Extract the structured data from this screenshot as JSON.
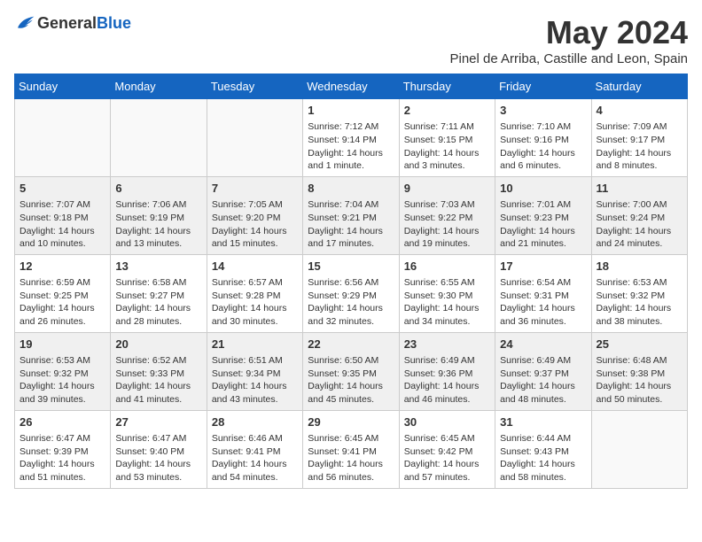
{
  "logo": {
    "general": "General",
    "blue": "Blue"
  },
  "title": "May 2024",
  "location": "Pinel de Arriba, Castille and Leon, Spain",
  "days_of_week": [
    "Sunday",
    "Monday",
    "Tuesday",
    "Wednesday",
    "Thursday",
    "Friday",
    "Saturday"
  ],
  "weeks": [
    [
      {
        "day": "",
        "info": ""
      },
      {
        "day": "",
        "info": ""
      },
      {
        "day": "",
        "info": ""
      },
      {
        "day": "1",
        "sunrise": "Sunrise: 7:12 AM",
        "sunset": "Sunset: 9:14 PM",
        "daylight": "Daylight: 14 hours and 1 minute."
      },
      {
        "day": "2",
        "sunrise": "Sunrise: 7:11 AM",
        "sunset": "Sunset: 9:15 PM",
        "daylight": "Daylight: 14 hours and 3 minutes."
      },
      {
        "day": "3",
        "sunrise": "Sunrise: 7:10 AM",
        "sunset": "Sunset: 9:16 PM",
        "daylight": "Daylight: 14 hours and 6 minutes."
      },
      {
        "day": "4",
        "sunrise": "Sunrise: 7:09 AM",
        "sunset": "Sunset: 9:17 PM",
        "daylight": "Daylight: 14 hours and 8 minutes."
      }
    ],
    [
      {
        "day": "5",
        "sunrise": "Sunrise: 7:07 AM",
        "sunset": "Sunset: 9:18 PM",
        "daylight": "Daylight: 14 hours and 10 minutes."
      },
      {
        "day": "6",
        "sunrise": "Sunrise: 7:06 AM",
        "sunset": "Sunset: 9:19 PM",
        "daylight": "Daylight: 14 hours and 13 minutes."
      },
      {
        "day": "7",
        "sunrise": "Sunrise: 7:05 AM",
        "sunset": "Sunset: 9:20 PM",
        "daylight": "Daylight: 14 hours and 15 minutes."
      },
      {
        "day": "8",
        "sunrise": "Sunrise: 7:04 AM",
        "sunset": "Sunset: 9:21 PM",
        "daylight": "Daylight: 14 hours and 17 minutes."
      },
      {
        "day": "9",
        "sunrise": "Sunrise: 7:03 AM",
        "sunset": "Sunset: 9:22 PM",
        "daylight": "Daylight: 14 hours and 19 minutes."
      },
      {
        "day": "10",
        "sunrise": "Sunrise: 7:01 AM",
        "sunset": "Sunset: 9:23 PM",
        "daylight": "Daylight: 14 hours and 21 minutes."
      },
      {
        "day": "11",
        "sunrise": "Sunrise: 7:00 AM",
        "sunset": "Sunset: 9:24 PM",
        "daylight": "Daylight: 14 hours and 24 minutes."
      }
    ],
    [
      {
        "day": "12",
        "sunrise": "Sunrise: 6:59 AM",
        "sunset": "Sunset: 9:25 PM",
        "daylight": "Daylight: 14 hours and 26 minutes."
      },
      {
        "day": "13",
        "sunrise": "Sunrise: 6:58 AM",
        "sunset": "Sunset: 9:27 PM",
        "daylight": "Daylight: 14 hours and 28 minutes."
      },
      {
        "day": "14",
        "sunrise": "Sunrise: 6:57 AM",
        "sunset": "Sunset: 9:28 PM",
        "daylight": "Daylight: 14 hours and 30 minutes."
      },
      {
        "day": "15",
        "sunrise": "Sunrise: 6:56 AM",
        "sunset": "Sunset: 9:29 PM",
        "daylight": "Daylight: 14 hours and 32 minutes."
      },
      {
        "day": "16",
        "sunrise": "Sunrise: 6:55 AM",
        "sunset": "Sunset: 9:30 PM",
        "daylight": "Daylight: 14 hours and 34 minutes."
      },
      {
        "day": "17",
        "sunrise": "Sunrise: 6:54 AM",
        "sunset": "Sunset: 9:31 PM",
        "daylight": "Daylight: 14 hours and 36 minutes."
      },
      {
        "day": "18",
        "sunrise": "Sunrise: 6:53 AM",
        "sunset": "Sunset: 9:32 PM",
        "daylight": "Daylight: 14 hours and 38 minutes."
      }
    ],
    [
      {
        "day": "19",
        "sunrise": "Sunrise: 6:53 AM",
        "sunset": "Sunset: 9:32 PM",
        "daylight": "Daylight: 14 hours and 39 minutes."
      },
      {
        "day": "20",
        "sunrise": "Sunrise: 6:52 AM",
        "sunset": "Sunset: 9:33 PM",
        "daylight": "Daylight: 14 hours and 41 minutes."
      },
      {
        "day": "21",
        "sunrise": "Sunrise: 6:51 AM",
        "sunset": "Sunset: 9:34 PM",
        "daylight": "Daylight: 14 hours and 43 minutes."
      },
      {
        "day": "22",
        "sunrise": "Sunrise: 6:50 AM",
        "sunset": "Sunset: 9:35 PM",
        "daylight": "Daylight: 14 hours and 45 minutes."
      },
      {
        "day": "23",
        "sunrise": "Sunrise: 6:49 AM",
        "sunset": "Sunset: 9:36 PM",
        "daylight": "Daylight: 14 hours and 46 minutes."
      },
      {
        "day": "24",
        "sunrise": "Sunrise: 6:49 AM",
        "sunset": "Sunset: 9:37 PM",
        "daylight": "Daylight: 14 hours and 48 minutes."
      },
      {
        "day": "25",
        "sunrise": "Sunrise: 6:48 AM",
        "sunset": "Sunset: 9:38 PM",
        "daylight": "Daylight: 14 hours and 50 minutes."
      }
    ],
    [
      {
        "day": "26",
        "sunrise": "Sunrise: 6:47 AM",
        "sunset": "Sunset: 9:39 PM",
        "daylight": "Daylight: 14 hours and 51 minutes."
      },
      {
        "day": "27",
        "sunrise": "Sunrise: 6:47 AM",
        "sunset": "Sunset: 9:40 PM",
        "daylight": "Daylight: 14 hours and 53 minutes."
      },
      {
        "day": "28",
        "sunrise": "Sunrise: 6:46 AM",
        "sunset": "Sunset: 9:41 PM",
        "daylight": "Daylight: 14 hours and 54 minutes."
      },
      {
        "day": "29",
        "sunrise": "Sunrise: 6:45 AM",
        "sunset": "Sunset: 9:41 PM",
        "daylight": "Daylight: 14 hours and 56 minutes."
      },
      {
        "day": "30",
        "sunrise": "Sunrise: 6:45 AM",
        "sunset": "Sunset: 9:42 PM",
        "daylight": "Daylight: 14 hours and 57 minutes."
      },
      {
        "day": "31",
        "sunrise": "Sunrise: 6:44 AM",
        "sunset": "Sunset: 9:43 PM",
        "daylight": "Daylight: 14 hours and 58 minutes."
      },
      {
        "day": "",
        "info": ""
      }
    ]
  ]
}
